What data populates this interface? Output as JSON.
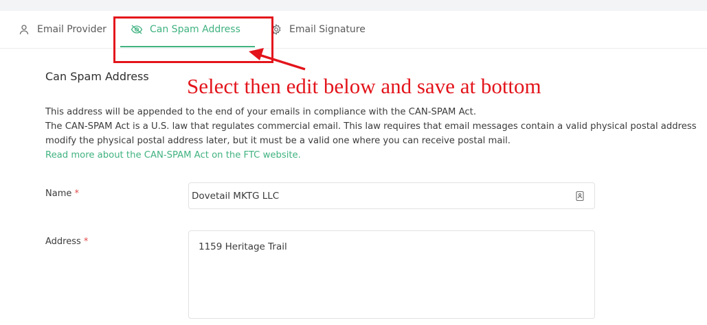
{
  "tabs": [
    {
      "label": "Email Provider",
      "icon": "user-icon"
    },
    {
      "label": "Can Spam Address",
      "icon": "eye-off-icon",
      "active": true
    },
    {
      "label": "Email Signature",
      "icon": "gear-icon"
    }
  ],
  "annotation": {
    "text": "Select then edit below and save at bottom",
    "color": "#e3141b"
  },
  "section": {
    "title": "Can Spam Address",
    "description_lines": [
      "This address will be appended to the end of your emails in compliance with the CAN-SPAM Act.",
      "The CAN-SPAM Act is a U.S. law that regulates commercial email. This law requires that email messages contain a valid physical postal address",
      "modify the physical postal address later, but it must be a valid one where you can receive postal mail."
    ],
    "link_text": "Read more about the CAN-SPAM Act on the FTC website."
  },
  "form": {
    "name_label": "Name",
    "name_value": "Dovetail MKTG LLC",
    "address_label": "Address",
    "address_value": "1159 Heritage Trail",
    "required_mark": "*"
  },
  "colors": {
    "accent": "#3fb27f",
    "annotation_red": "#e3141b",
    "required": "#e24b4b"
  }
}
